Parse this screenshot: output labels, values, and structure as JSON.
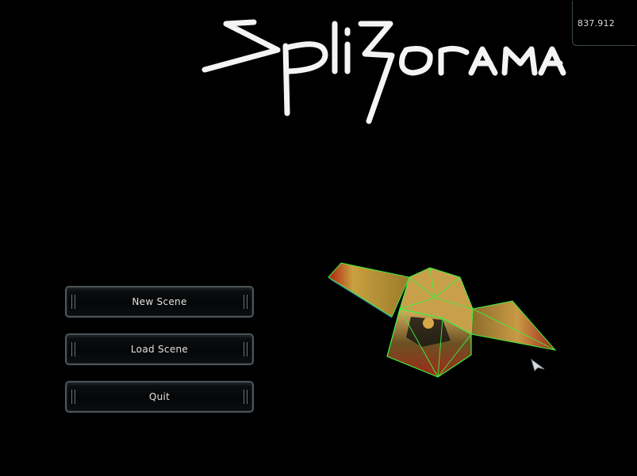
{
  "hud": {
    "fps_value": "837.912"
  },
  "title": {
    "logo_text": "Splitorama"
  },
  "menu": {
    "buttons": [
      {
        "label": "New Scene"
      },
      {
        "label": "Load Scene"
      },
      {
        "label": "Quit"
      }
    ]
  },
  "scene": {
    "model_icon": "spaceship-model",
    "cursor_icon": "arrow-cursor-icon",
    "wireframe_color": "#3df23d"
  }
}
